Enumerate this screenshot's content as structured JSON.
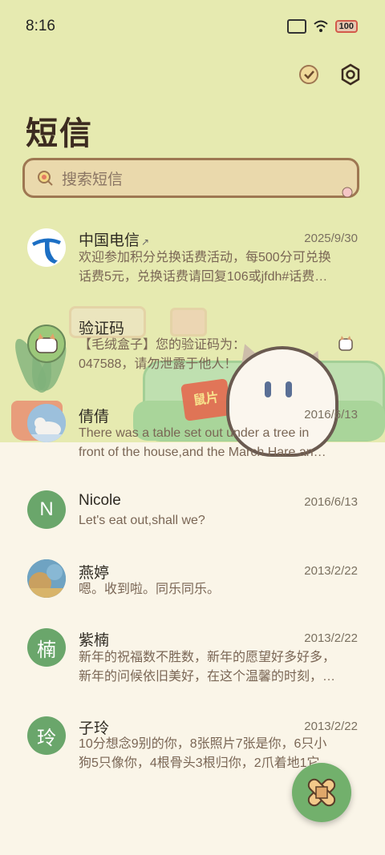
{
  "status_bar": {
    "time": "8:16",
    "battery": "100"
  },
  "header": {
    "title": "短信"
  },
  "search": {
    "placeholder": "搜索短信"
  },
  "messages": [
    {
      "name": "中国电信",
      "date": "2025/9/30",
      "preview_line1": "欢迎参加积分兑换话费活动，每500分可兑换",
      "preview_line2": "话费5元，兑换话费请回复106或jfdh#话费…"
    },
    {
      "name": "验证码",
      "date": "",
      "preview_line1": "【毛绒盒子】您的验证码为：",
      "preview_line2": "047588，请勿泄露于他人！"
    },
    {
      "name": "倩倩",
      "date": "2016/6/13",
      "preview_line1": "There was a table set out under a tree in",
      "preview_line2": "front of the house,and the March Hare an…"
    },
    {
      "name": "Nicole",
      "letter": "N",
      "date": "2016/6/13",
      "preview_line1": "Let's eat out,shall we?"
    },
    {
      "name": "燕婷",
      "date": "2013/2/22",
      "preview_line1": "嗯。收到啦。同乐同乐。"
    },
    {
      "name": "紫楠",
      "letter": "楠",
      "date": "2013/2/22",
      "preview_line1": "新年的祝福数不胜数，新年的愿望好多好多，",
      "preview_line2": "新年的问候依旧美好，在这个温馨的时刻，…"
    },
    {
      "name": "子玲",
      "letter": "玲",
      "date": "2013/2/22",
      "preview_line1": "10分想念9别的你，8张照片7张是你，6只小",
      "preview_line2": "狗5只像你，4根骨头3根归你，2爪着地1它…"
    }
  ],
  "scene": {
    "chip_text": "鼠片"
  },
  "colors": {
    "accent": "#72b06c",
    "title": "#3c2b20",
    "search_border": "#9e7752"
  }
}
